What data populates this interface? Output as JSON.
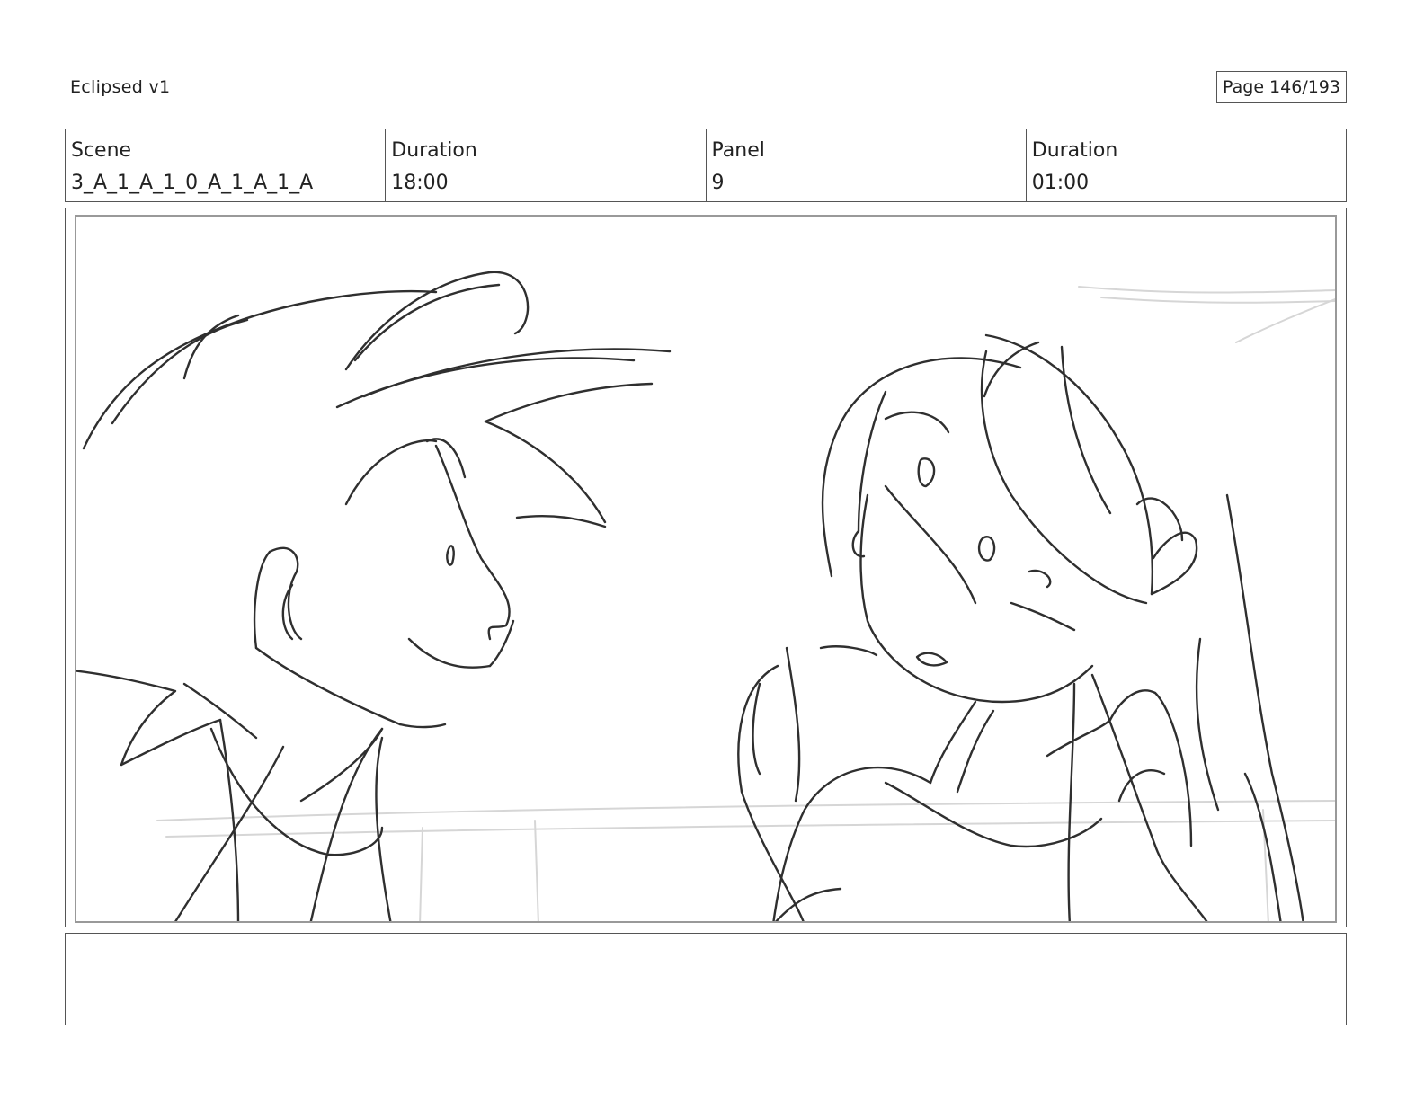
{
  "header": {
    "doc_title": "Eclipsed v1",
    "page_label": "Page 146/193"
  },
  "info": {
    "scene_label": "Scene",
    "scene_value": "3_A_1_A_1_0_A_1_A_1_A",
    "scene_duration_label": "Duration",
    "scene_duration_value": "18:00",
    "panel_label": "Panel",
    "panel_value": "9",
    "panel_duration_label": "Duration",
    "panel_duration_value": "01:00"
  },
  "notes": {
    "text": ""
  },
  "drawing": {
    "ink_color": "#2f2f2f",
    "guide_color": "#d6d6d6",
    "icon": "storyboard-sketch"
  }
}
